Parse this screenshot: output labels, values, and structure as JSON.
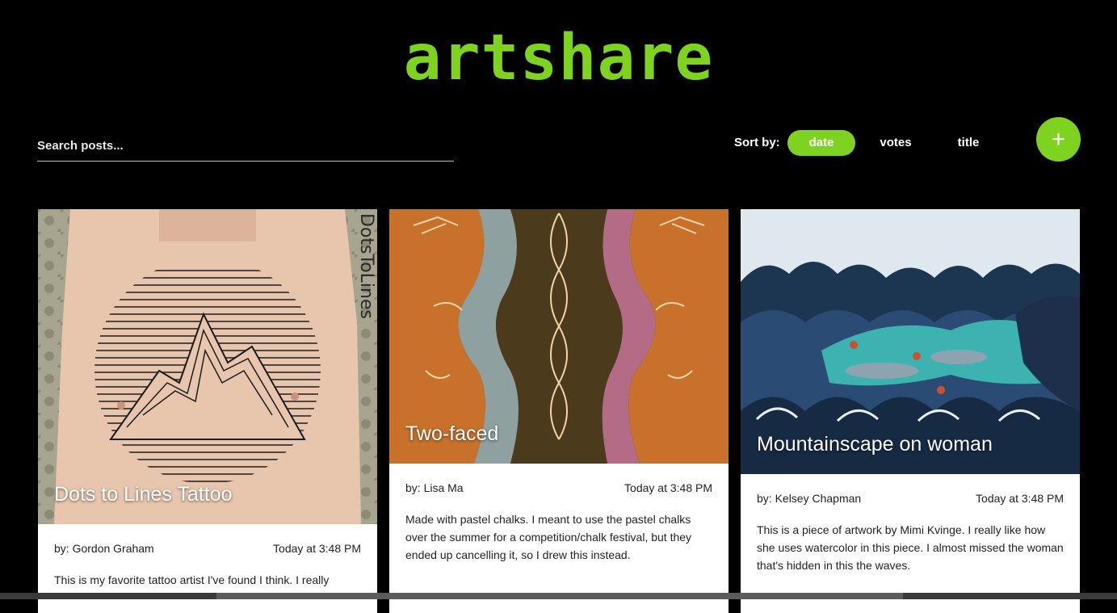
{
  "app": {
    "logo": "artshare"
  },
  "search": {
    "placeholder": "Search posts..."
  },
  "sort": {
    "label": "Sort by:",
    "options": [
      {
        "label": "date",
        "active": true
      },
      {
        "label": "votes",
        "active": false
      },
      {
        "label": "title",
        "active": false
      }
    ]
  },
  "add_button": {
    "icon": "plus-icon",
    "symbol": "+"
  },
  "accent_color": "#7ed321",
  "posts": [
    {
      "title": "Dots to Lines Tattoo",
      "author": "by: Gordon Graham",
      "time": "Today at 3:48 PM",
      "description": "This is my favorite tattoo artist I've found I think. I really",
      "watermark": "DotsToLines"
    },
    {
      "title": "Two-faced",
      "author": "by: Lisa Ma",
      "time": "Today at 3:48 PM",
      "description": "Made with pastel chalks. I meant to use the pastel chalks over the summer for a competition/chalk festival, but they ended up cancelling it, so I drew this instead."
    },
    {
      "title": "Mountainscape on woman",
      "author": "by: Kelsey Chapman",
      "time": "Today at 3:48 PM",
      "description": "This is a piece of artwork by Mimi Kvinge. I really like how she uses watercolor in this piece. I almost missed the woman that's hidden in this the waves."
    }
  ]
}
